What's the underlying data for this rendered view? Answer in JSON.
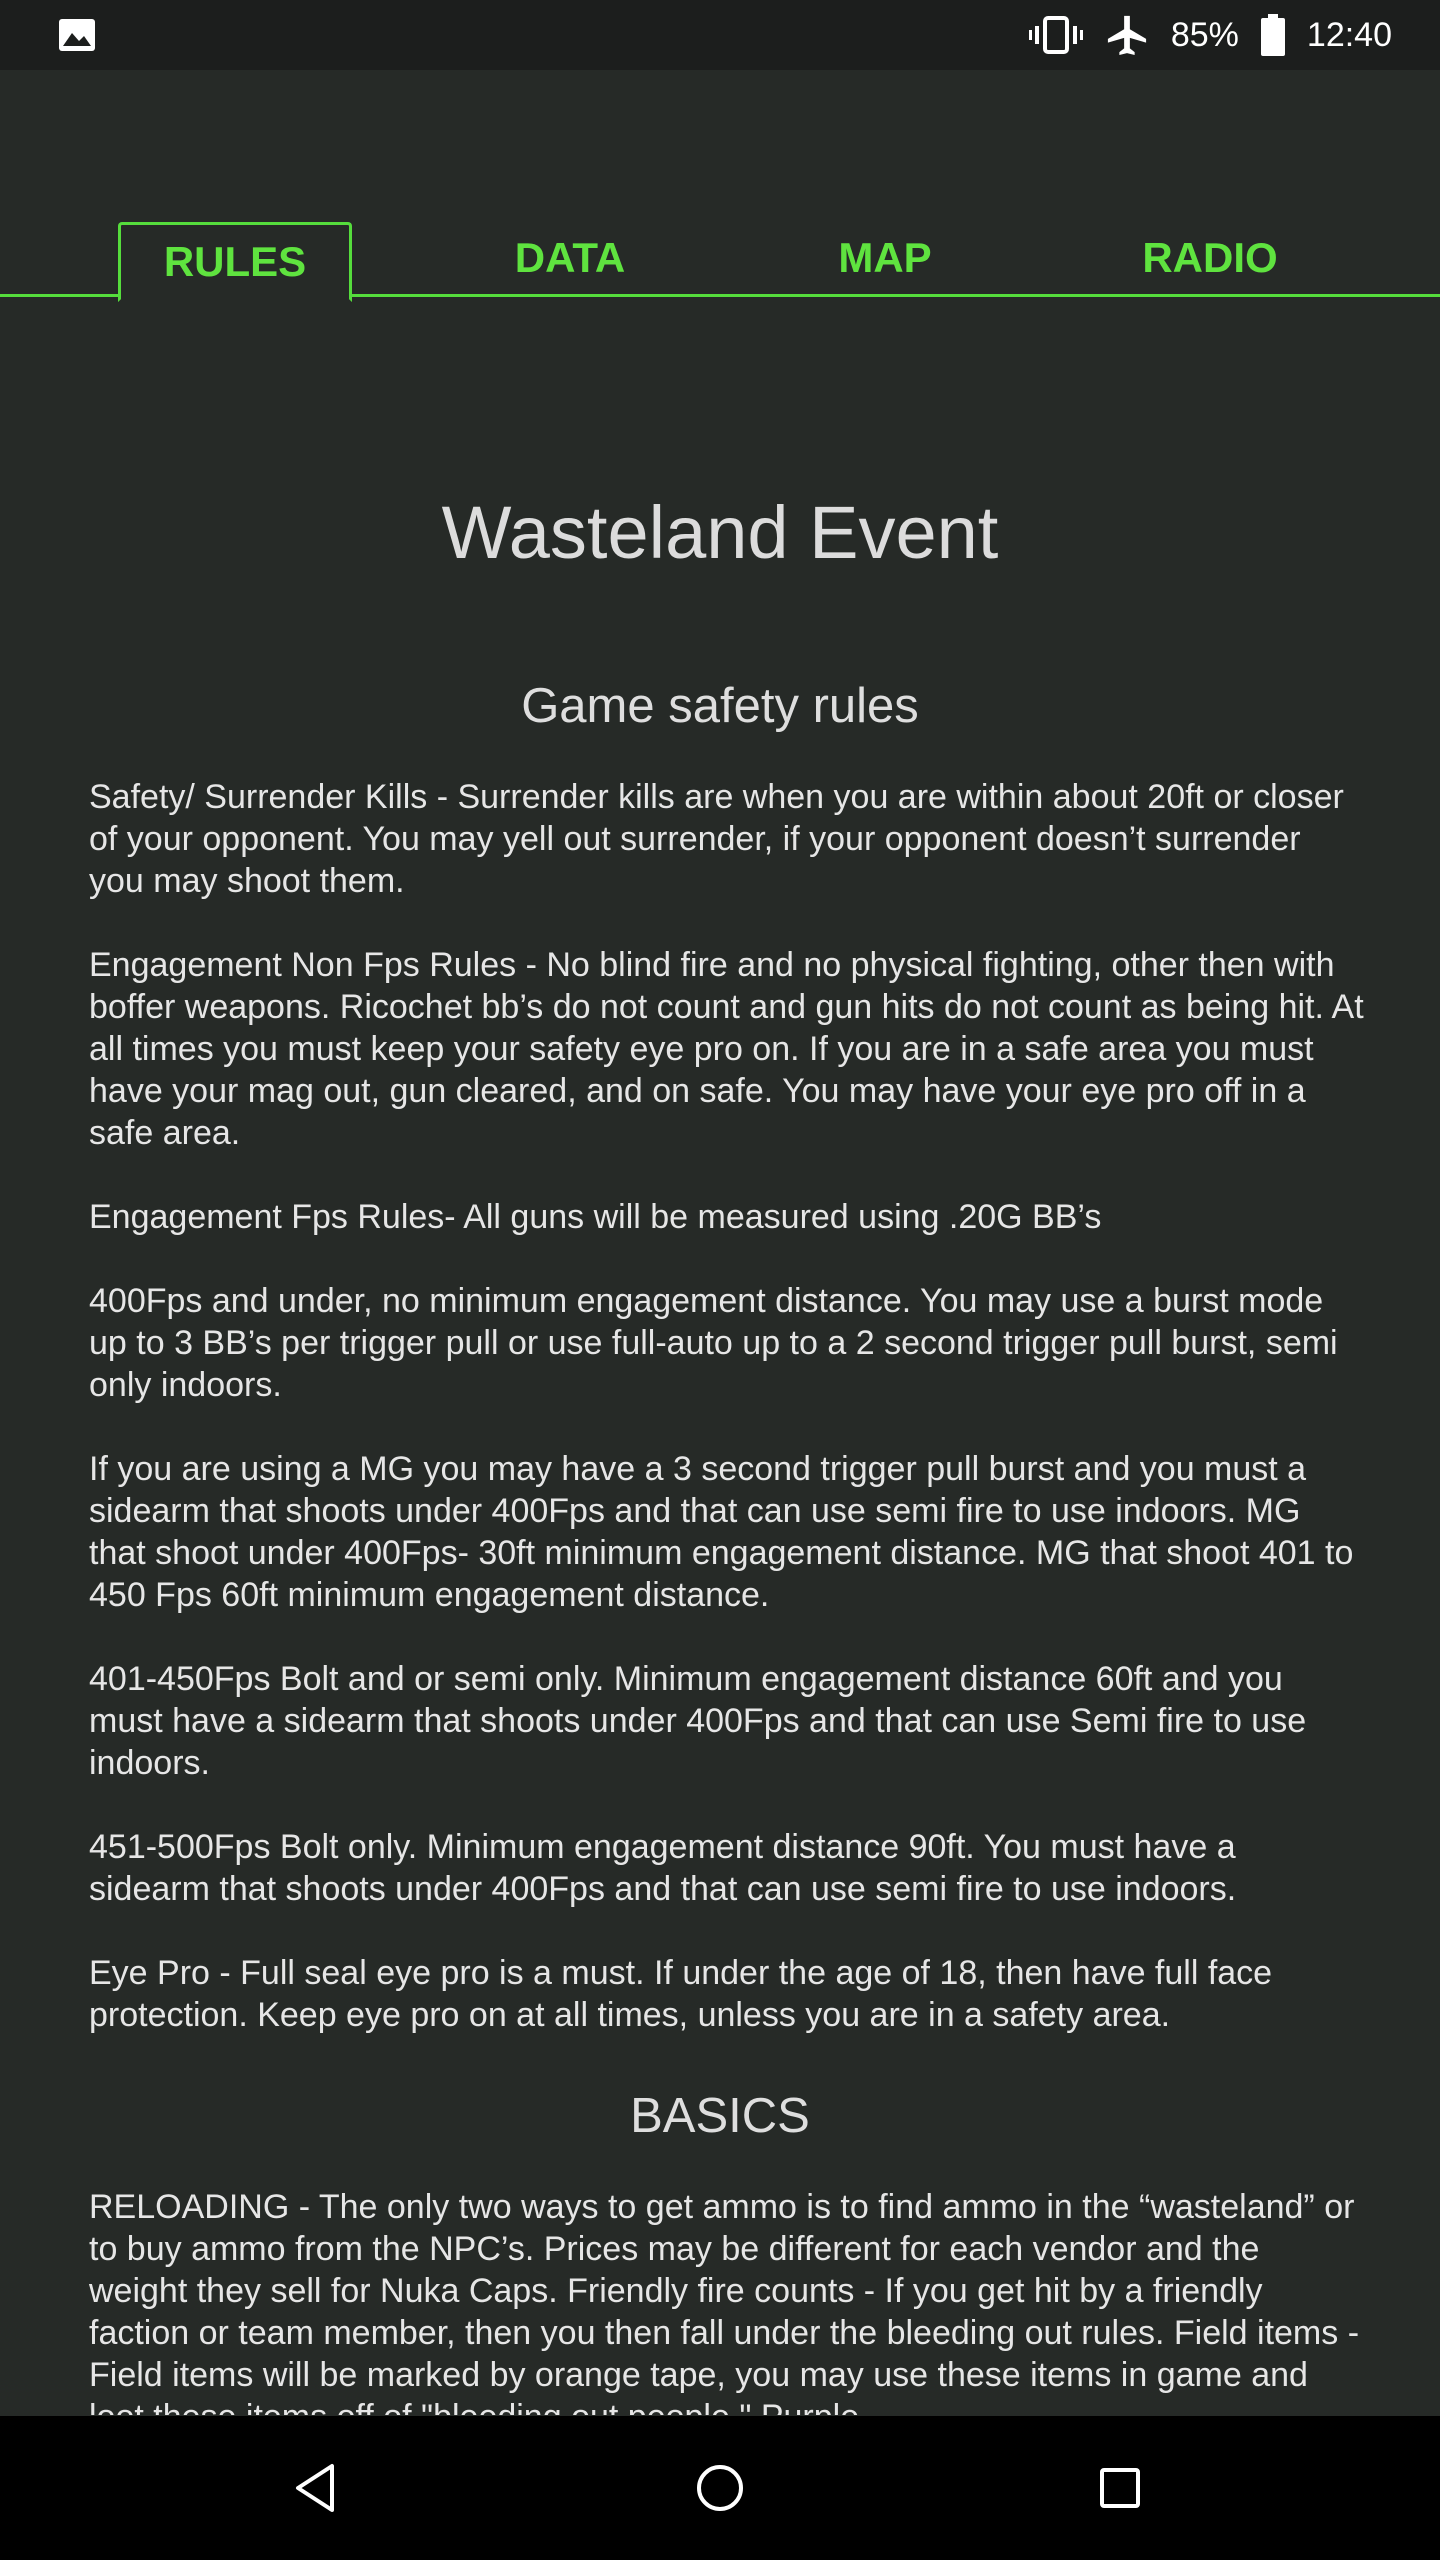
{
  "status_bar": {
    "battery": "85%",
    "time": "12:40",
    "icons": [
      "image-icon",
      "vibrate-icon",
      "airplane-icon",
      "battery-icon"
    ]
  },
  "tabs": [
    {
      "label": "RULES",
      "active": true
    },
    {
      "label": "DATA",
      "active": false
    },
    {
      "label": "MAP",
      "active": false
    },
    {
      "label": "RADIO",
      "active": false
    }
  ],
  "page": {
    "title": "Wasteland Event",
    "sections": [
      {
        "heading": "Game safety rules",
        "paragraphs": [
          "Safety/ Surrender Kills - Surrender kills are when you are within about 20ft or closer of your opponent. You may yell out surrender, if your opponent doesn’t surrender you may shoot them.",
          "Engagement Non Fps Rules - No blind fire and no physical fighting, other then with boffer weapons. Ricochet bb’s do not count and gun hits do not count as being hit. At all times you must keep your safety eye pro on. If you are in a safe area you must have your mag out, gun cleared, and on safe. You may have your eye pro off in a safe area.",
          "Engagement Fps Rules- All guns will be measured using .20G BB’s",
          "400Fps and under, no minimum engagement distance. You may use a burst mode up to 3 BB’s per trigger pull or use full-auto up to a 2 second trigger pull burst, semi only indoors.",
          "If you are using a MG you may have a 3 second trigger pull burst and you must a sidearm that shoots under 400Fps and that can use semi fire to use indoors. MG that shoot under 400Fps- 30ft minimum engagement distance. MG that shoot 401 to 450 Fps 60ft minimum engagement distance.",
          "401-450Fps  Bolt and or semi only. Minimum engagement distance 60ft and you must have a sidearm that shoots under 400Fps and that can use Semi fire to use indoors.",
          "451-500Fps Bolt only.  Minimum engagement distance 90ft. You must have a sidearm that shoots under 400Fps and that can use semi fire to use indoors.",
          "Eye Pro - Full seal eye pro is a must. If under the age of 18, then have full face protection. Keep eye pro on at all times, unless you are in a safety area."
        ]
      },
      {
        "heading": "BASICS",
        "paragraphs": [
          "RELOADING - The only two ways to get ammo is to find ammo in the “wasteland” or to buy ammo from the NPC’s. Prices may be different for each vendor and the weight they sell for Nuka Caps. Friendly fire counts - If you get hit by a friendly faction or team member, then you then fall under the bleeding out rules. Field items - Field items will be marked by orange tape, you may use these items in game and loot these items off of \"bleeding out people.\" Purple"
        ]
      }
    ]
  },
  "nav_bar": {
    "buttons": [
      "back-icon",
      "home-icon",
      "recents-icon"
    ]
  }
}
